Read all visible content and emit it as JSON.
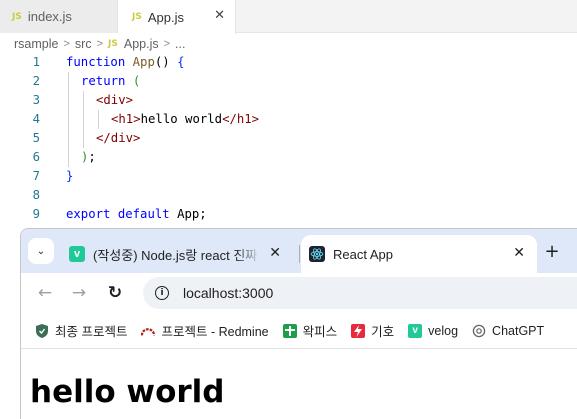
{
  "editor": {
    "tabs": [
      {
        "badge": "JS",
        "label": "index.js"
      },
      {
        "badge": "JS",
        "label": "App.js",
        "close": "✕"
      }
    ],
    "breadcrumb": {
      "items": [
        "rsample",
        "src",
        "App.js",
        "..."
      ],
      "separator": ">",
      "file_badge": "JS"
    },
    "lines": [
      {
        "num": "1",
        "parts": [
          {
            "t": "function ",
            "c": "kw"
          },
          {
            "t": "App",
            "c": "fn"
          },
          {
            "t": "() ",
            "c": "txt"
          },
          {
            "t": "{",
            "c": "br1"
          }
        ]
      },
      {
        "num": "2",
        "parts": [
          {
            "t": "return ",
            "c": "kw"
          },
          {
            "t": "(",
            "c": "br2"
          }
        ]
      },
      {
        "num": "3",
        "parts": [
          {
            "t": "<div>",
            "c": "tag"
          }
        ]
      },
      {
        "num": "4",
        "parts": [
          {
            "t": "<h1>",
            "c": "tag"
          },
          {
            "t": "hello world",
            "c": "txt"
          },
          {
            "t": "</h1>",
            "c": "tag"
          }
        ]
      },
      {
        "num": "5",
        "parts": [
          {
            "t": "</div>",
            "c": "tag"
          }
        ]
      },
      {
        "num": "6",
        "parts": [
          {
            "t": ")",
            "c": "br2"
          },
          {
            "t": ";",
            "c": "txt"
          }
        ]
      },
      {
        "num": "7",
        "parts": [
          {
            "t": "}",
            "c": "br1"
          }
        ]
      },
      {
        "num": "8",
        "parts": []
      },
      {
        "num": "9",
        "parts": [
          {
            "t": "export ",
            "c": "kw"
          },
          {
            "t": "default ",
            "c": "kw"
          },
          {
            "t": "App;",
            "c": "txt"
          }
        ]
      }
    ]
  },
  "browser": {
    "tabs": [
      {
        "label": "(작성중) Node.js랑 react 진짜 간단",
        "favicon": "v",
        "close": "✕"
      },
      {
        "label": "React App",
        "favicon": "react-logo",
        "close": "✕"
      }
    ],
    "tab_search_icon": "⌄",
    "new_tab_label": "+",
    "nav": {
      "back": "←",
      "forward": "→",
      "reload": "↻"
    },
    "info_icon": "i",
    "url": "localhost:3000",
    "bookmarks": [
      {
        "label": "최종 프로젝트",
        "icon": "shield-icon",
        "color": "#3c6e57"
      },
      {
        "label": "프로젝트 - Redmine",
        "icon": "redmine-icon",
        "color": "#b32024"
      },
      {
        "label": "왁피스",
        "icon": "cross-icon",
        "color": "#1e9e4a"
      },
      {
        "label": "기호",
        "icon": "lightning-icon",
        "color": "#e8283c"
      },
      {
        "label": "velog",
        "icon": "velog-icon",
        "color": "#20c997"
      },
      {
        "label": "ChatGPT",
        "icon": "chatgpt-icon",
        "color": "#5f6368"
      }
    ],
    "page_heading": "hello world"
  }
}
